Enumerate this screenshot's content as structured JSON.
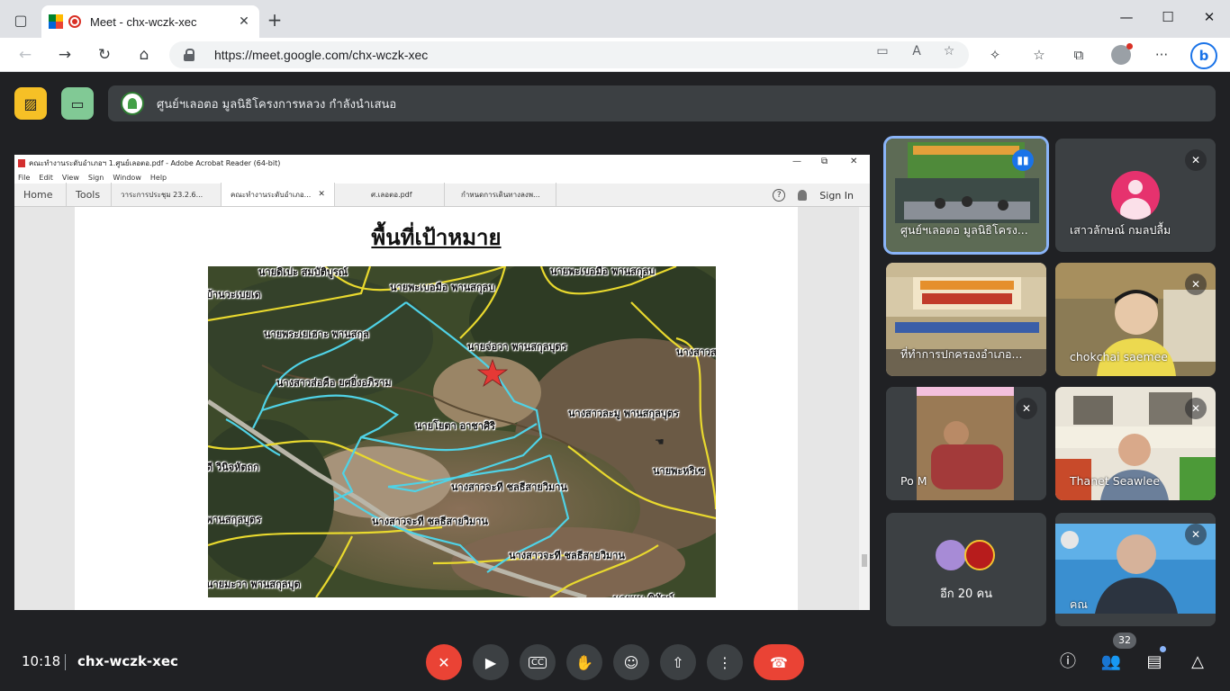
{
  "browser": {
    "tab_title": "Meet - chx-wczk-xec",
    "url": "https://meet.google.com/chx-wczk-xec",
    "tab_close_glyph": "✕",
    "new_tab_glyph": "+"
  },
  "presenter": {
    "text": "ศูนย์ฯเลอตอ มูลนิธิโครงการหลวง กำลังนำเสนอ"
  },
  "acrobat": {
    "window_title": "คณะทำงานระดับอำเภอฯ 1.ศูนย์เลอตอ.pdf - Adobe Acrobat Reader (64-bit)",
    "menu": [
      "File",
      "Edit",
      "View",
      "Sign",
      "Window",
      "Help"
    ],
    "tabs": {
      "home": "Home",
      "tools": "Tools",
      "doc1": "วาระการประชุม 23.2.6...",
      "doc2": "คณะทำงานระดับอำเภอ...",
      "doc3": "ศ.เลอตอ.pdf",
      "doc4": "กำหนดการเดินทางลงพ..."
    },
    "sign_in": "Sign In"
  },
  "slide": {
    "title": "พื้นที่เป้าหมาย",
    "map_labels": [
      "นายดิเปะ สมบัติบูรณ์",
      "นายพะเบอมือ พานสกุลบ",
      "บ้านวะเบยเด",
      "นายพะเบอมือ พานสกุลบ",
      "นายพระเยเฮาะ พานสกุล",
      "นายจ่อวา พานสกุลบุตร",
      "นางสาวส",
      "นางสาวส่อคือ ยศยิ่งอภิราม",
      "นางสาวละมู พานสกุลบุตร",
      "นายโยตา อาชาศิริ",
      "นายพะหริเซ",
      "ดี วินิจหัตถก",
      "นางสาวจะที ชลธีสายวิมาน",
      "พานสกุลบุตร",
      "นางสาวจะที ชลธีสายวิมาน",
      "นางสาวจะที ชลธีสายวิมาน",
      "นายมะวา พานสกุลบุต",
      "นายหน พิทักษ์"
    ]
  },
  "participants": [
    {
      "name": "ศูนย์ฯเลอตอ มูลนิธิโครง...",
      "speaking": true
    },
    {
      "name": "เสาวลักษณ์ กมลปลื้ม",
      "muted": true
    },
    {
      "name": "ที่ทำการปกครองอำเภอ..."
    },
    {
      "name": "chokchai saemee",
      "muted": true
    },
    {
      "name": "Po M",
      "muted": true
    },
    {
      "name": "Thanet Seawlee",
      "muted": true
    },
    {
      "name": "อีก 20 คน"
    },
    {
      "name": "คณ",
      "muted": true
    }
  ],
  "meeting": {
    "time": "10:18",
    "code": "chx-wczk-xec",
    "participant_count": "32"
  },
  "icons": {
    "mic_off": "mic-off-icon",
    "camera": "videocam-icon",
    "captions": "closed-caption-icon",
    "raise_hand": "hand-icon",
    "emoji": "emoji-icon",
    "present": "present-icon",
    "more": "more-vert-icon",
    "leave": "call-end-icon"
  },
  "colors": {
    "meet_bg": "#202124",
    "tile_bg": "#3c4043",
    "danger": "#ea4335",
    "speaking_outline": "#8ab4f8",
    "brand_yellow": "#f6c026",
    "brand_green": "#81c995"
  }
}
